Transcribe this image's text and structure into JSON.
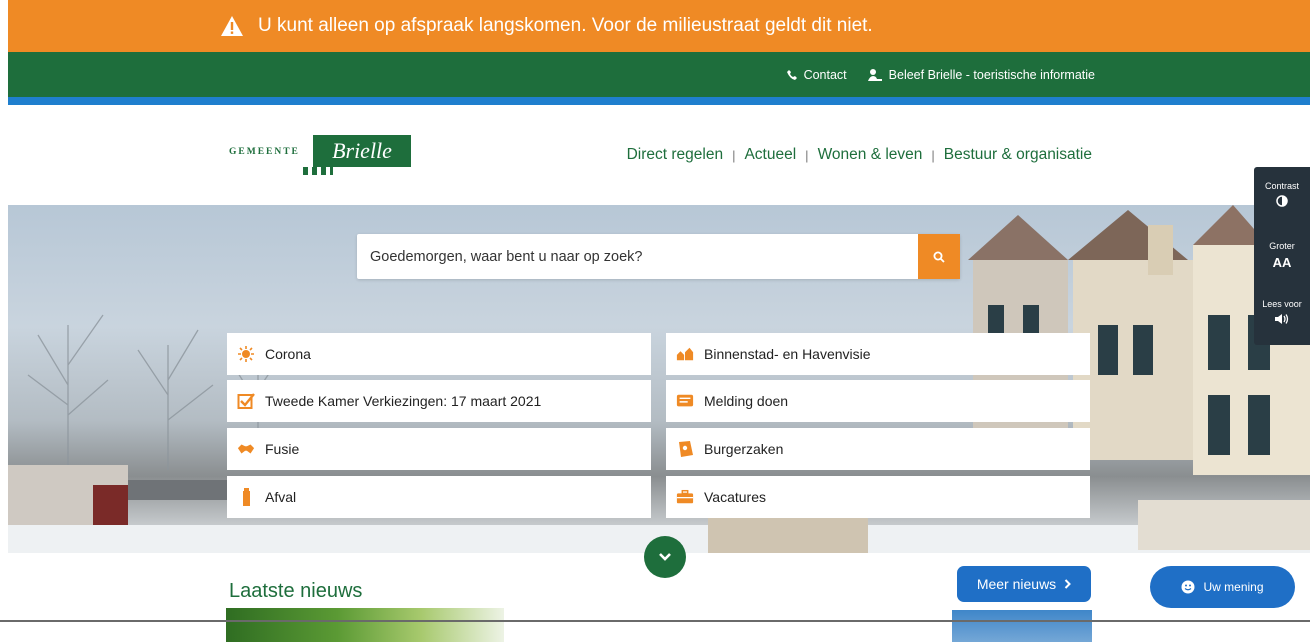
{
  "alert": {
    "text": "U kunt alleen op afspraak langskomen. Voor de milieustraat geldt dit niet.",
    "color": "#ef8a25"
  },
  "topbar": {
    "contact": "Contact",
    "tourism": "Beleef Brielle - toeristische informatie",
    "color": "#1e6e3c"
  },
  "logo": {
    "small": "GEMEENTE",
    "big": "Brielle"
  },
  "nav": {
    "items": [
      "Direct regelen",
      "Actueel",
      "Wonen & leven",
      "Bestuur & organisatie"
    ]
  },
  "search": {
    "placeholder": "Goedemorgen, waar bent u naar op zoek?"
  },
  "tiles": [
    {
      "label": "Corona",
      "icon": "virus-icon"
    },
    {
      "label": "Binnenstad- en Havenvisie",
      "icon": "city-icon"
    },
    {
      "label": "Tweede Kamer Verkiezingen: 17 maart 2021",
      "icon": "checkbox-icon"
    },
    {
      "label": "Melding doen",
      "icon": "report-icon"
    },
    {
      "label": "Fusie",
      "icon": "handshake-icon"
    },
    {
      "label": "Burgerzaken",
      "icon": "id-card-icon"
    },
    {
      "label": "Afval",
      "icon": "waste-icon"
    },
    {
      "label": "Vacatures",
      "icon": "briefcase-icon"
    }
  ],
  "accessibility": {
    "contrast": "Contrast",
    "bigger": "Groter",
    "read": "Lees voor",
    "bigger_symbol": "AA"
  },
  "news": {
    "title": "Laatste nieuws",
    "more": "Meer nieuws"
  },
  "feedback": {
    "label": "Uw mening"
  },
  "accent_orange": "#ef8a25",
  "accent_blue": "#1f6fc6"
}
